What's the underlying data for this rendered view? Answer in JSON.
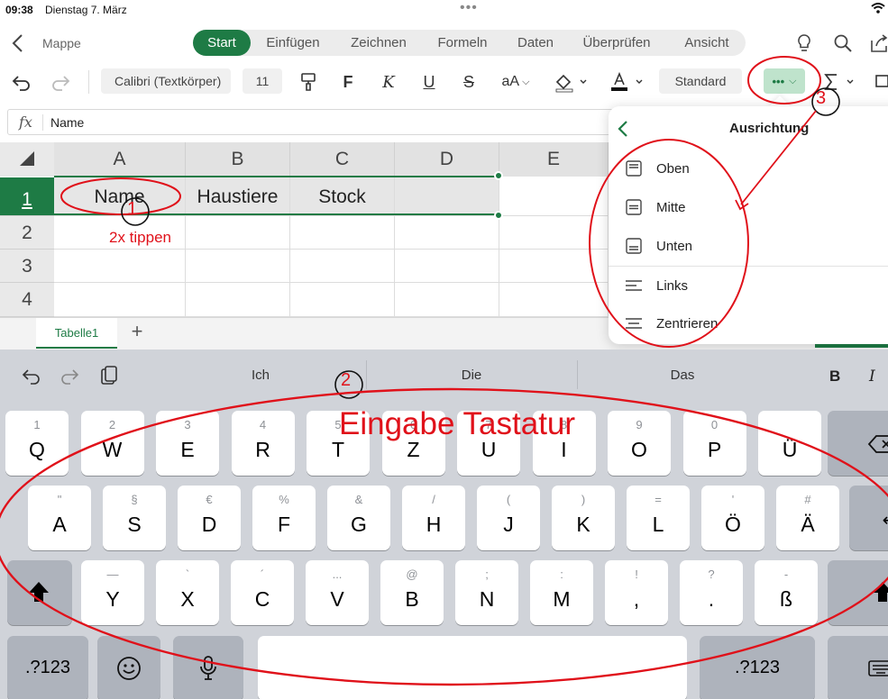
{
  "status_bar": {
    "time": "09:38",
    "date": "Dienstag 7. März"
  },
  "header": {
    "doc_name": "Mappe",
    "tabs": [
      "Start",
      "Einfügen",
      "Zeichnen",
      "Formeln",
      "Daten",
      "Überprüfen",
      "Ansicht"
    ],
    "active_tab": "Start"
  },
  "toolbar": {
    "font": "Calibri (Textkörper)",
    "font_size": "11",
    "bold": "F",
    "italic": "K",
    "underline": "U",
    "strike": "S",
    "text_size": "aA",
    "number_format": "Standard",
    "more": "•••"
  },
  "formula_bar": {
    "fx": "fx",
    "value": "Name"
  },
  "grid": {
    "columns": [
      "A",
      "B",
      "C",
      "D",
      "E"
    ],
    "rows": [
      "1",
      "2",
      "3",
      "4"
    ],
    "cells": {
      "A1": "Name",
      "B1": "Haustiere",
      "C1": "Stock"
    }
  },
  "sheets": {
    "active": "Tabelle1",
    "add": "+"
  },
  "popover": {
    "title": "Ausrichtung",
    "items": [
      "Oben",
      "Mitte",
      "Unten",
      "Links",
      "Zentrieren"
    ]
  },
  "keyboard": {
    "suggestions": [
      "Ich",
      "Die",
      "Das"
    ],
    "format_bold": "B",
    "format_italic": "I",
    "row1": [
      [
        "1",
        "Q"
      ],
      [
        "2",
        "W"
      ],
      [
        "3",
        "E"
      ],
      [
        "4",
        "R"
      ],
      [
        "5",
        "T"
      ],
      [
        "6",
        "Z"
      ],
      [
        "7",
        "U"
      ],
      [
        "8",
        "I"
      ],
      [
        "9",
        "O"
      ],
      [
        "0",
        "P"
      ],
      [
        "",
        "Ü"
      ]
    ],
    "row2": [
      [
        "\"",
        "A"
      ],
      [
        "§",
        "S"
      ],
      [
        "€",
        "D"
      ],
      [
        "%",
        "F"
      ],
      [
        "&",
        "G"
      ],
      [
        "/",
        "H"
      ],
      [
        "(",
        "J"
      ],
      [
        ")",
        "K"
      ],
      [
        "=",
        "L"
      ],
      [
        "'",
        "Ö"
      ],
      [
        "#",
        "Ä"
      ]
    ],
    "row3": [
      [
        "—",
        "Y"
      ],
      [
        "`",
        "X"
      ],
      [
        "´",
        "C"
      ],
      [
        "...",
        "V"
      ],
      [
        "@",
        "B"
      ],
      [
        ";",
        "N"
      ],
      [
        ":",
        "M"
      ],
      [
        "!",
        ","
      ],
      [
        "?",
        "."
      ],
      [
        "-",
        "ß"
      ]
    ],
    "mode_key": ".?123"
  },
  "annotations": {
    "step1": "1",
    "step1_text": "2x tippen",
    "step2": "2",
    "step2_text": "Eingabe Tastatur",
    "step3": "3",
    "color": "#e0111a"
  }
}
